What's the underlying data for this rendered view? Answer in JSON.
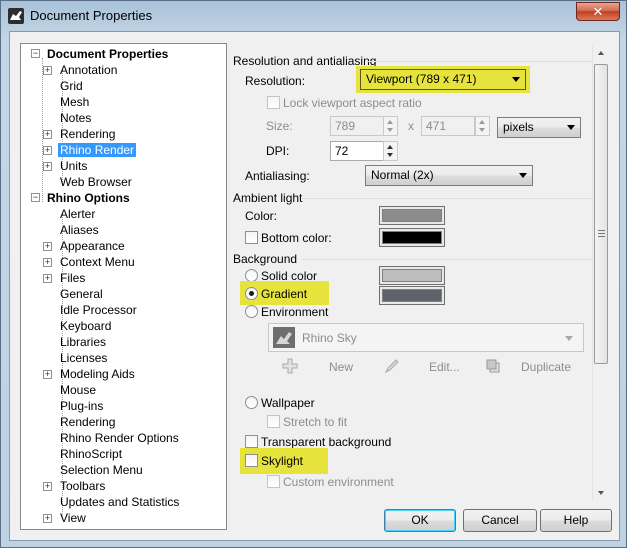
{
  "window": {
    "title": "Document Properties",
    "close_glyph": "✕"
  },
  "tree": {
    "document_properties": "Document Properties",
    "doc_items": [
      "Annotation",
      "Grid",
      "Mesh",
      "Notes",
      "Rendering",
      "Rhino Render",
      "Units",
      "Web Browser"
    ],
    "rhino_options": "Rhino Options",
    "option_items": [
      "Alerter",
      "Aliases",
      "Appearance",
      "Context Menu",
      "Files",
      "General",
      "Idle Processor",
      "Keyboard",
      "Libraries",
      "Licenses",
      "Modeling Aids",
      "Mouse",
      "Plug-ins",
      "Rendering",
      "Rhino Render Options",
      "RhinoScript",
      "Selection Menu",
      "Toolbars",
      "Updates and Statistics",
      "View"
    ],
    "selected": "Rhino Render"
  },
  "resolution": {
    "section": "Resolution and antialiasing",
    "resolution_label": "Resolution:",
    "resolution_value": "Viewport  (789 x 471)",
    "lock_aspect": "Lock viewport aspect ratio",
    "size_label": "Size:",
    "width": "789",
    "times": "x",
    "height": "471",
    "unit": "pixels",
    "dpi_label": "DPI:",
    "dpi": "72",
    "antialias_label": "Antialiasing:",
    "antialias_value": "Normal (2x)"
  },
  "ambient": {
    "section": "Ambient light",
    "color_label": "Color:",
    "color": "#8c8c8c",
    "bottom_label": "Bottom color:",
    "bottom_color": "#000000"
  },
  "background": {
    "section": "Background",
    "solid": "Solid color",
    "solid_color": "#bdbdbd",
    "gradient": "Gradient",
    "gradient_color": "#5f6369",
    "environment": "Environment",
    "env_name": "Rhino Sky",
    "new": "New",
    "edit": "Edit...",
    "duplicate": "Duplicate",
    "wallpaper": "Wallpaper",
    "stretch": "Stretch to fit",
    "transparent": "Transparent background"
  },
  "skylight": {
    "label": "Skylight",
    "custom_env": "Custom environment"
  },
  "buttons": {
    "ok": "OK",
    "cancel": "Cancel",
    "help": "Help"
  },
  "colors": {
    "highlight": "#e6e43c",
    "selection": "#3399ff"
  }
}
